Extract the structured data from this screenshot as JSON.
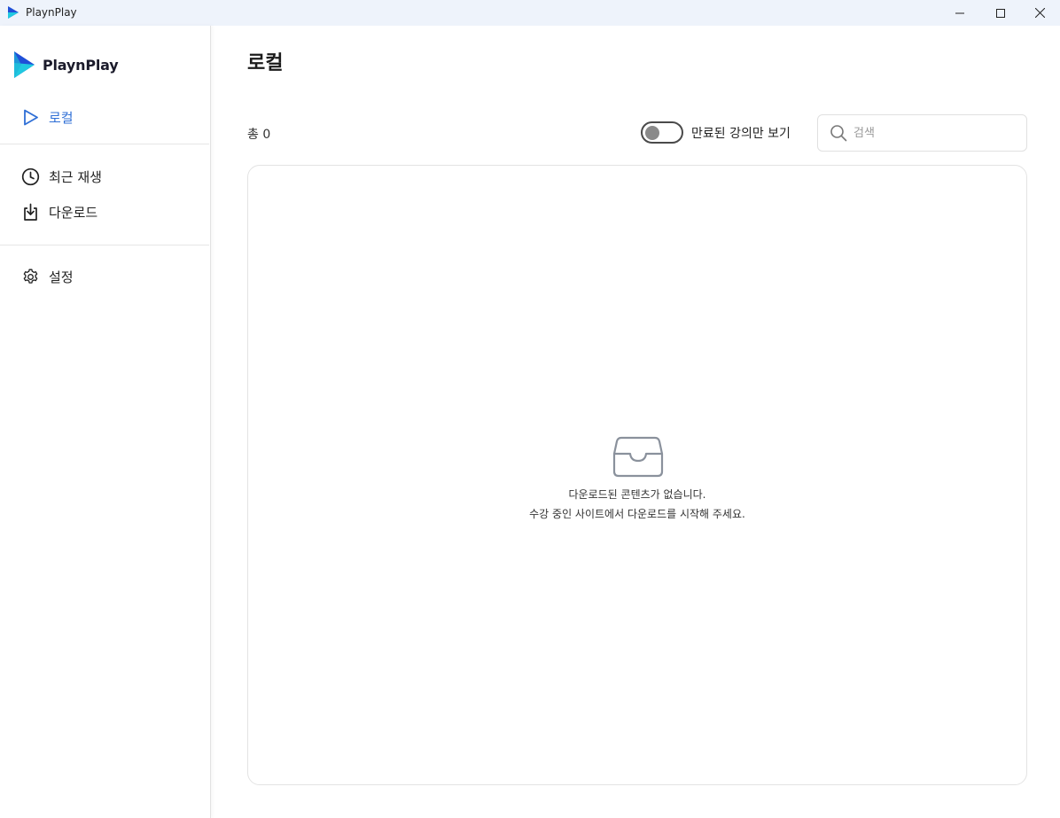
{
  "window": {
    "title": "PlaynPlay",
    "icon": "playnplay-logo-icon",
    "controls": [
      "minimize-icon",
      "maximize-icon",
      "close-icon"
    ]
  },
  "sidebar": {
    "logo_text": "PlaynPlay",
    "items": [
      {
        "label": "로컬",
        "icon": "play-outline-icon",
        "active": true
      },
      {
        "label": "최근 재생",
        "icon": "clock-icon",
        "active": false
      },
      {
        "label": "다운로드",
        "icon": "download-icon",
        "active": false
      },
      {
        "label": "설정",
        "icon": "gear-icon",
        "active": false
      }
    ]
  },
  "main": {
    "title": "로컬",
    "total_label": "총 0",
    "toggle": {
      "label": "만료된 강의만 보기",
      "on": false
    },
    "search": {
      "placeholder": "검색",
      "value": ""
    },
    "empty_state": {
      "icon": "inbox-tray-icon",
      "line1": "다운로드된 콘텐츠가 없습니다.",
      "line2": "수강 중인 사이트에서 다운로드를 시작해 주세요."
    }
  },
  "colors": {
    "accent": "#2f6fd6",
    "titlebar_bg": "#eef3fb",
    "logo_blue": "#1f4fd8",
    "logo_cyan": "#20c9e0"
  }
}
